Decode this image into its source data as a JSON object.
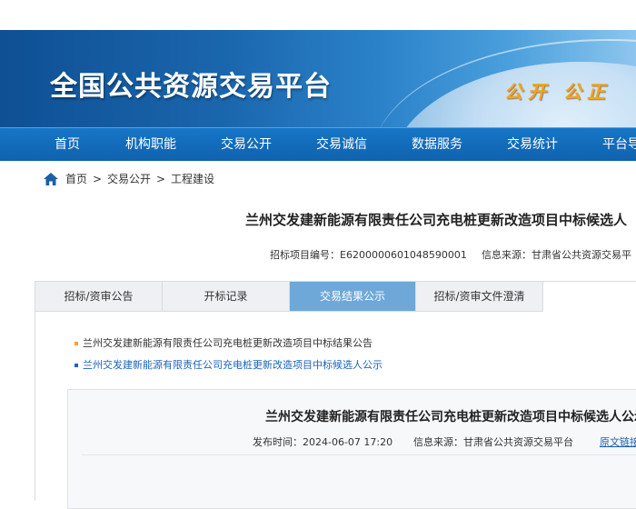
{
  "banner": {
    "title": "全国公共资源交易平台",
    "slogan": "公开 公正"
  },
  "nav": {
    "items": [
      {
        "label": "首页"
      },
      {
        "label": "机构职能"
      },
      {
        "label": "交易公开"
      },
      {
        "label": "交易诚信"
      },
      {
        "label": "数据服务"
      },
      {
        "label": "交易统计"
      },
      {
        "label": "平台导"
      }
    ]
  },
  "breadcrumb": {
    "home": "首页",
    "sep": ">",
    "level2": "交易公开",
    "level3": "工程建设"
  },
  "article": {
    "title": "兰州交发建新能源有限责任公司充电桩更新改造项目中标候选人",
    "project_no": "招标项目编号：E6200000601048590001",
    "source": "信息来源：甘肃省公共资源交易平"
  },
  "tabs": [
    {
      "label": "招标/资审公告",
      "active": false
    },
    {
      "label": "开标记录",
      "active": false
    },
    {
      "label": "交易结果公示",
      "active": true
    },
    {
      "label": "招标/资审文件澄清",
      "active": false
    }
  ],
  "list": [
    {
      "text": "兰州交发建新能源有限责任公司充电桩更新改造项目中标结果公告",
      "color": "#333333",
      "bullet_color": "#f0a63a"
    },
    {
      "text": "兰州交发建新能源有限责任公司充电桩更新改造项目中标候选人公示",
      "color": "#1b63b8",
      "bullet_color": "#1b63b8"
    }
  ],
  "sub": {
    "title": "兰州交发建新能源有限责任公司充电桩更新改造项目中标候选人公示",
    "publish_time": "发布时间：2024-06-07 17:20",
    "source": "信息来源：甘肃省公共资源交易平台",
    "link": "原文链接"
  },
  "colors": {
    "nav_bg": "#1170c0",
    "active_tab": "#6ea8d8",
    "link": "#1b5fb0"
  }
}
